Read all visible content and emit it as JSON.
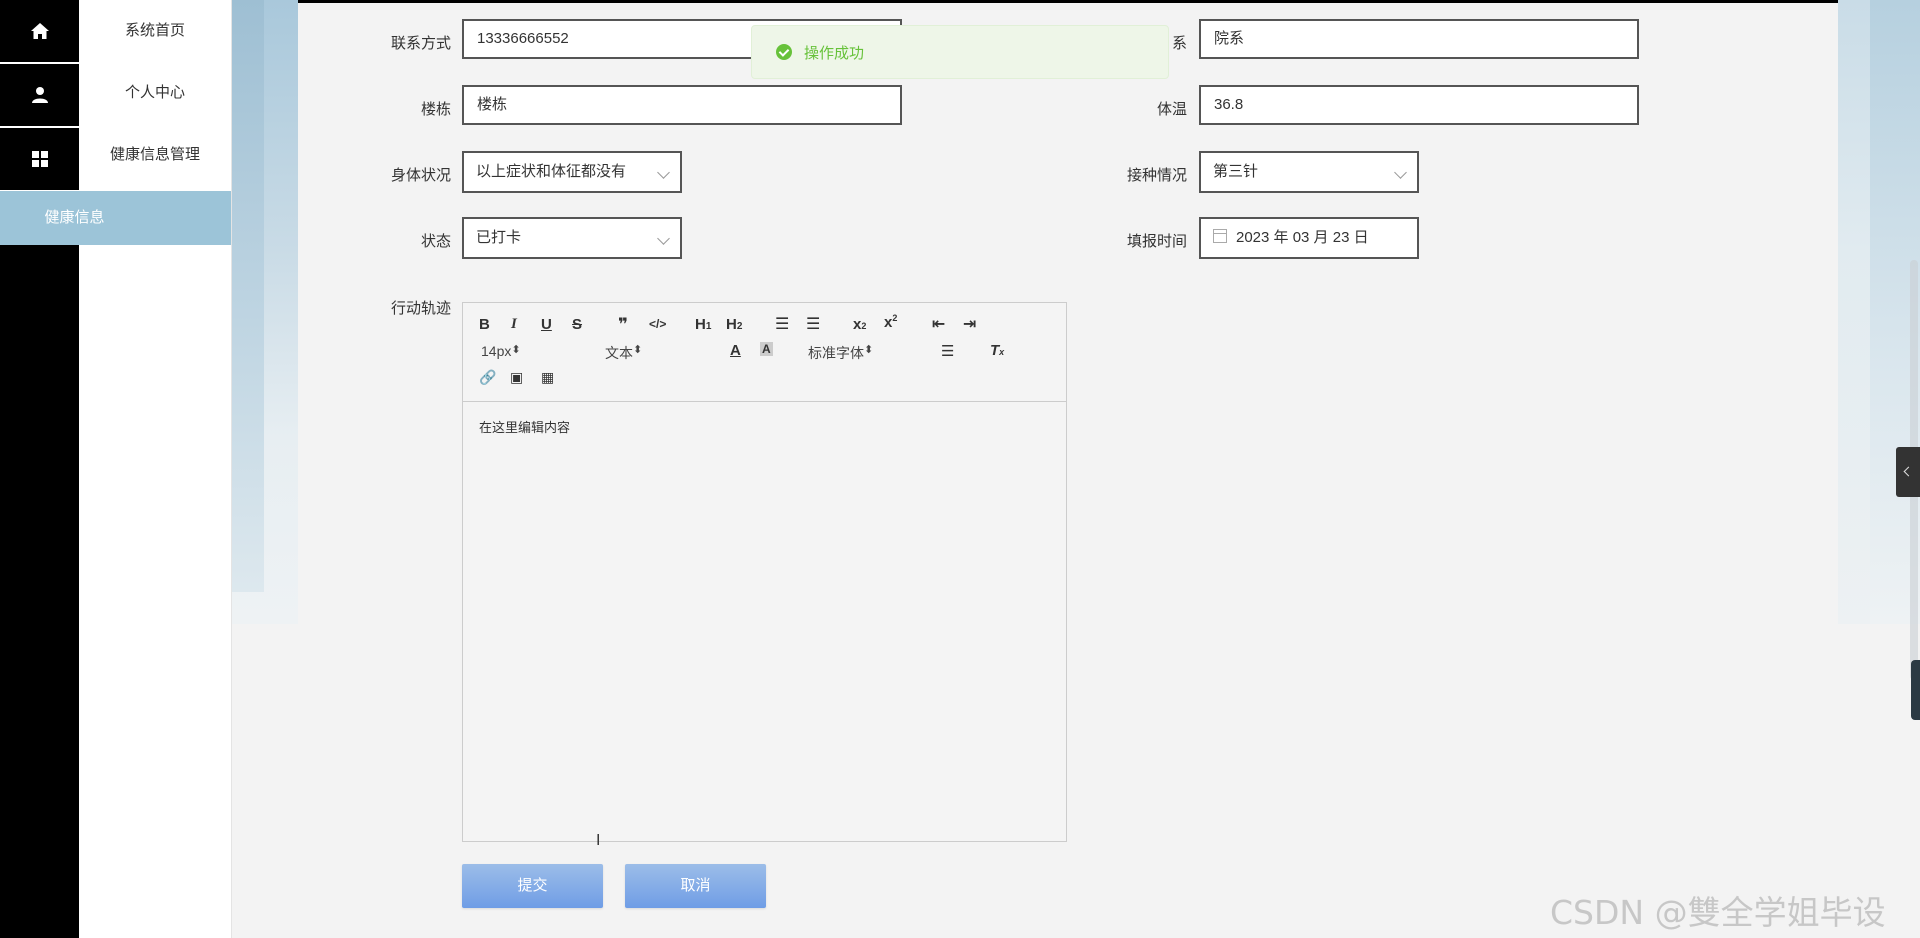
{
  "nav": {
    "items": [
      {
        "label": "系统首页",
        "icon": "home-icon"
      },
      {
        "label": "个人中心",
        "icon": "user-icon"
      },
      {
        "label": "健康信息管理",
        "icon": "grid-icon"
      }
    ],
    "active_sub": "健康信息"
  },
  "toast": {
    "message": "操作成功"
  },
  "form": {
    "contact": {
      "label": "联系方式",
      "value": "13336666552"
    },
    "department": {
      "label": "院系",
      "label_visible": "系",
      "value": "院系"
    },
    "building": {
      "label": "楼栋",
      "value": "楼栋"
    },
    "temperature": {
      "label": "体温",
      "value": "36.8"
    },
    "health": {
      "label": "身体状况",
      "value": "以上症状和体征都没有"
    },
    "vaccination": {
      "label": "接种情况",
      "value": "第三针"
    },
    "status": {
      "label": "状态",
      "value": "已打卡"
    },
    "report_time": {
      "label": "填报时间",
      "value": "2023 年 03 月 23 日"
    },
    "trajectory": {
      "label": "行动轨迹"
    }
  },
  "editor": {
    "font_size": "14px",
    "format": "文本",
    "font": "标准字体",
    "placeholder": "在这里编辑内容"
  },
  "buttons": {
    "submit": "提交",
    "cancel": "取消"
  },
  "watermark": "CSDN @雙全学姐毕设",
  "colors": {
    "accent": "#9cc4d8",
    "success": "#67c23a",
    "button": "#7ba4e6"
  }
}
